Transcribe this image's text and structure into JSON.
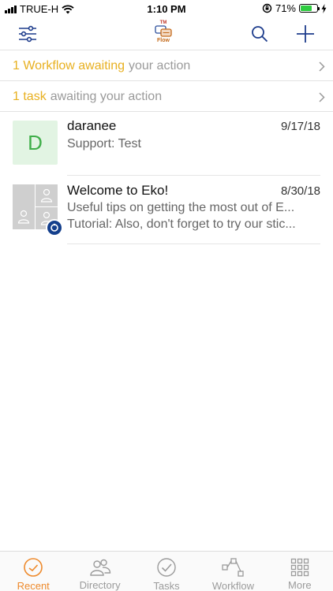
{
  "status_bar": {
    "carrier": "TRUE-H",
    "time": "1:10 PM",
    "battery_percent": "71%",
    "battery_level": 0.71
  },
  "nav": {
    "logo_tm": "TM",
    "logo_caption": "Flow",
    "icons": [
      "filter-sliders-icon",
      "search-icon",
      "plus-icon"
    ]
  },
  "banners": {
    "workflow": {
      "highlight": "1 Workflow awaiting",
      "rest": "your action"
    },
    "task": {
      "highlight": "1 task",
      "rest": "awaiting your action"
    }
  },
  "conversations": [
    {
      "avatar_letter": "D",
      "title": "daranee",
      "date": "9/17/18",
      "line1": "Support: Test"
    },
    {
      "title": "Welcome to Eko!",
      "date": "8/30/18",
      "line1": "Useful tips on getting the most out of E...",
      "line2": "Tutorial: Also, don't forget to try our stic..."
    }
  ],
  "tabs": [
    {
      "label": "Recent",
      "icon": "clock-icon",
      "active": true
    },
    {
      "label": "Directory",
      "icon": "people-icon",
      "active": false
    },
    {
      "label": "Tasks",
      "icon": "checkmark-circle-icon",
      "active": false
    },
    {
      "label": "Workflow",
      "icon": "workflow-icon",
      "active": false
    },
    {
      "label": "More",
      "icon": "grid-icon",
      "active": false
    }
  ],
  "colors": {
    "accent_orange": "#ee8a2c",
    "banner_highlight": "#e8b020",
    "nav_icon_blue": "#1d3c8c",
    "avatar_green": "#3fae49"
  }
}
